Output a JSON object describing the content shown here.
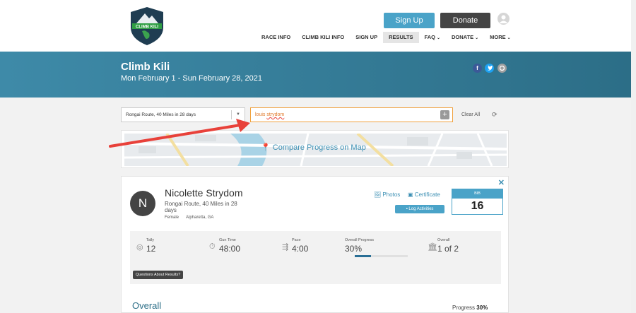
{
  "header": {
    "logo_text": "CLIMB KILI",
    "signup_label": "Sign Up",
    "donate_label": "Donate",
    "nav": [
      {
        "label": "RACE INFO",
        "dropdown": false,
        "active": false
      },
      {
        "label": "CLIMB KILI INFO",
        "dropdown": false,
        "active": false
      },
      {
        "label": "SIGN UP",
        "dropdown": false,
        "active": false
      },
      {
        "label": "RESULTS",
        "dropdown": false,
        "active": true
      },
      {
        "label": "FAQ",
        "dropdown": true,
        "active": false
      },
      {
        "label": "DONATE",
        "dropdown": true,
        "active": false
      },
      {
        "label": "MORE",
        "dropdown": true,
        "active": false
      }
    ]
  },
  "banner": {
    "title": "Climb Kili",
    "dates": "Mon February 1 - Sun February 28, 2021",
    "social": [
      "facebook-icon",
      "twitter-icon",
      "share-icon"
    ]
  },
  "filters": {
    "route_value": "Rongai Route, 40 Miles in 28 days",
    "search_value": "louis strydom",
    "clear_label": "Clear All"
  },
  "map": {
    "label": "Compare Progress on Map"
  },
  "result": {
    "initial": "N",
    "name": "Nicolette Strydom",
    "route": "Rongai Route, 40 Miles in 28 days",
    "gender": "Female",
    "location": "Alpharetta, GA",
    "photos_label": "Photos",
    "certificate_label": "Certificate",
    "log_label": "Log Activities",
    "bib_label": "BIB",
    "bib_number": "16",
    "stats": {
      "tally_label": "Tally",
      "tally": "12",
      "gun_label": "Gun Time",
      "gun": "48:00",
      "pace_label": "Pace",
      "pace": "4:00",
      "progress_label": "Overall Progress",
      "progress": "30%",
      "progress_fraction": 0.3,
      "overall_label": "Overall",
      "overall": "1 of 2"
    },
    "questions_label": "Questions About Results?",
    "overall_heading": "Overall",
    "progress_right_label": "Progress",
    "progress_right_value": "30%"
  },
  "colors": {
    "accent": "#4aa3c8",
    "banner": "#3e8aa8",
    "search_text": "#e07a2a",
    "arrow": "#e8413a"
  }
}
